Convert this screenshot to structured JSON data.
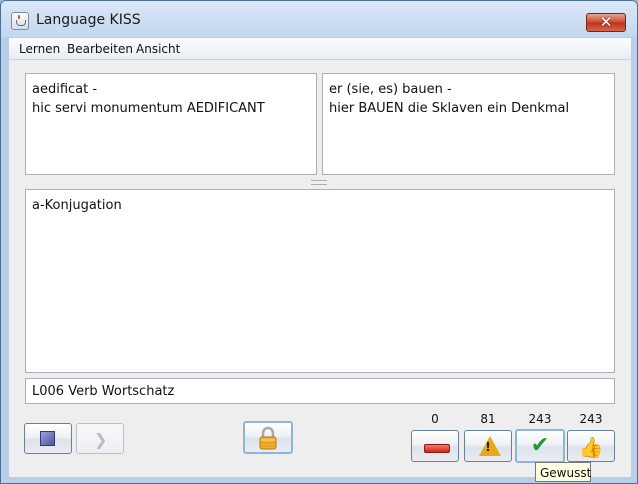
{
  "window": {
    "title": "Language KISS",
    "close_symbol": "✕"
  },
  "menu": {
    "items": [
      "Lernen",
      "Bearbeiten",
      "Ansicht"
    ]
  },
  "card": {
    "question_text": "aedificat -\nhic servi monumentum AEDIFICANT",
    "answer_text": "er (sie, es) bauen -\nhier BAUEN die Sklaven ein Denkmal",
    "notes_text": "a-Konjugation",
    "lesson": "L006 Verb Wortschatz"
  },
  "controls": {
    "stop_icon": "stop-square-icon",
    "next_icon": "next-arrow-icon",
    "lock_icon": "padlock-icon"
  },
  "rating": {
    "counts": [
      "0",
      "81",
      "243",
      "243"
    ],
    "icons": [
      "minus-icon",
      "warning-icon",
      "checkmark-icon",
      "thumbs-up-icon"
    ],
    "warn_glyph": "!",
    "check_glyph": "✔",
    "thumb_glyph": "👍",
    "tooltip": "Gewusst"
  },
  "colors": {
    "title_bar": "#c9dcf2",
    "close_button": "#c8482c",
    "tooltip_bg": "#ffffe1"
  }
}
